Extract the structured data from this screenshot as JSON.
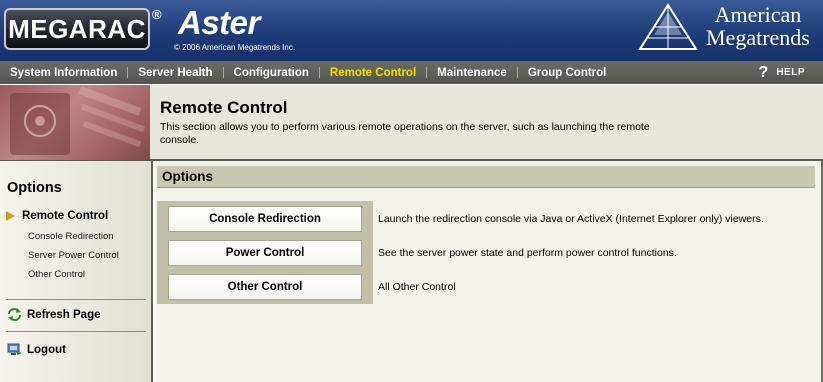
{
  "header": {
    "logo": "MEGARAC",
    "registered_mark": "®",
    "product": "Aster",
    "copyright": "© 2006 American Megatrends Inc.",
    "company_line1": "American",
    "company_line2": "Megatrends"
  },
  "nav": {
    "items": [
      {
        "label": "System Information",
        "active": false
      },
      {
        "label": "Server Health",
        "active": false
      },
      {
        "label": "Configuration",
        "active": false
      },
      {
        "label": "Remote Control",
        "active": true
      },
      {
        "label": "Maintenance",
        "active": false
      },
      {
        "label": "Group Control",
        "active": false
      }
    ],
    "help_icon": "?",
    "help_label": "HELP",
    "active_color": "#f5e000"
  },
  "banner": {
    "title": "Remote Control",
    "description": "This section allows you to perform various remote operations on the server, such as launching the remote console."
  },
  "sidebar": {
    "title": "Options",
    "current": "Remote Control",
    "sub_items": [
      "Console Redirection",
      "Server Power Control",
      "Other Control"
    ],
    "refresh_label": "Refresh Page",
    "logout_label": "Logout"
  },
  "main": {
    "section_title": "Options",
    "options": [
      {
        "button": "Console Redirection",
        "description": "Launch the redirection console via Java or ActiveX (Internet Explorer only) viewers."
      },
      {
        "button": "Power Control",
        "description": "See the server power state and perform power control functions."
      },
      {
        "button": "Other Control",
        "description": "All Other Control"
      }
    ]
  },
  "colors": {
    "header_blue": "#1f3c78",
    "nav_gray": "#545450",
    "accent_gold": "#cc9a1e",
    "panel_tan": "#c2bfa9"
  }
}
